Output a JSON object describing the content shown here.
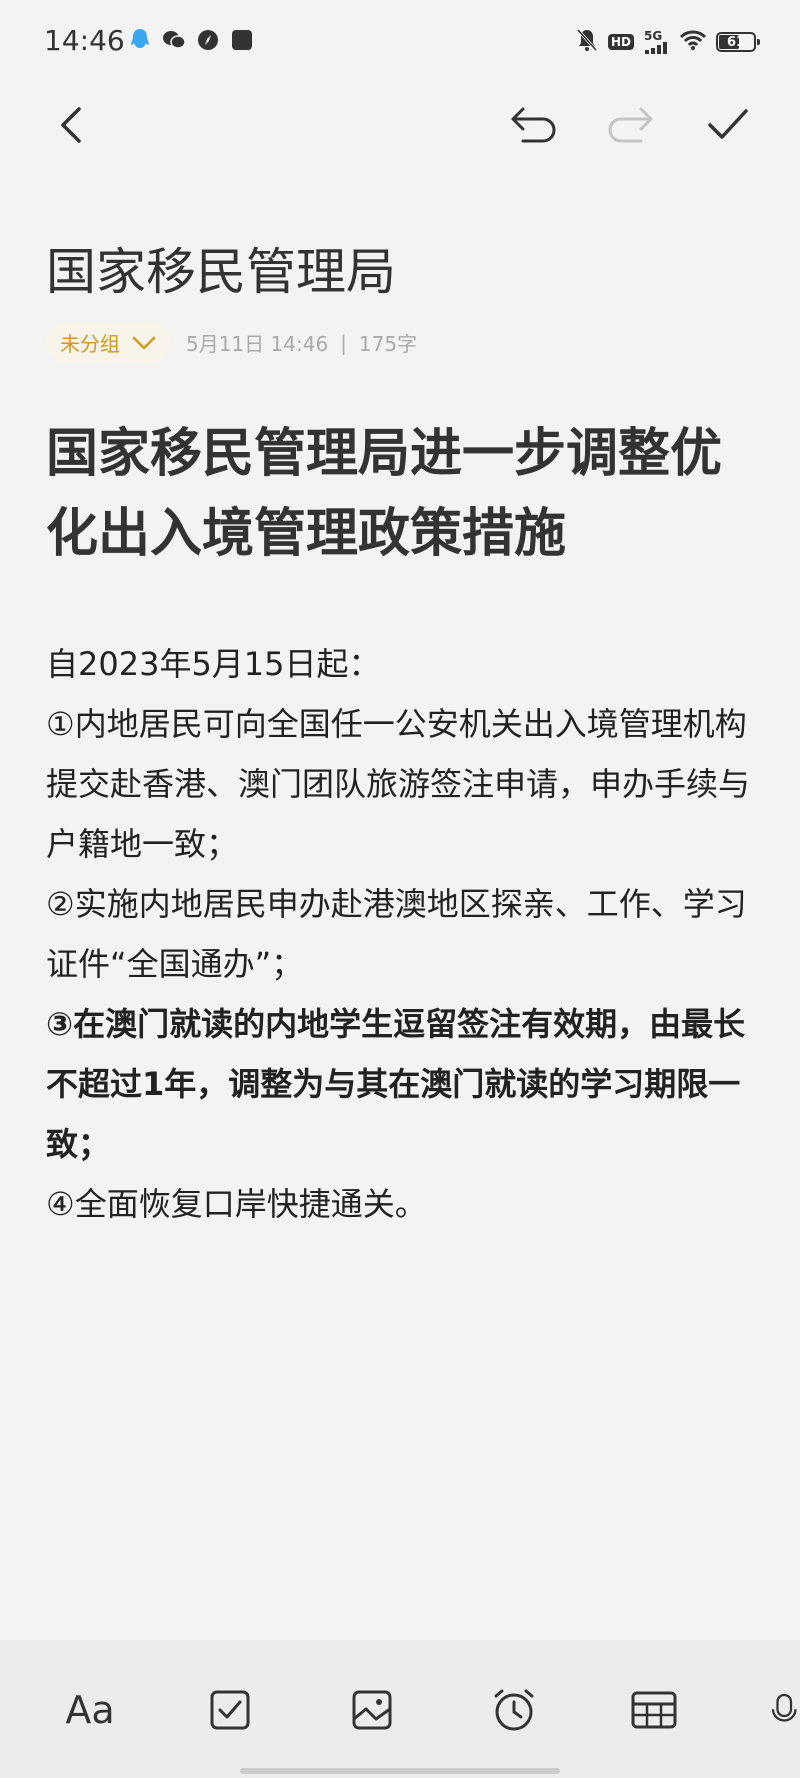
{
  "status_bar": {
    "time": "14:46",
    "network": "5G",
    "hd": "HD",
    "battery": "61",
    "battery_level": 0.61,
    "notification_icons": [
      "qq-icon",
      "wechat-icon",
      "compass-icon",
      "square-app-icon"
    ],
    "system_icons": [
      "bell-muted-icon",
      "hd-icon",
      "signal-5g-icon",
      "wifi-icon",
      "battery-icon"
    ]
  },
  "toolbar": {
    "icons": [
      "back-arrow-icon",
      "undo-icon",
      "redo-icon",
      "check-icon"
    ]
  },
  "note": {
    "title": "国家移民管理局",
    "group": "未分组",
    "date": "5月11日 14:46",
    "separator": "|",
    "word_count": "175字",
    "heading": "国家移民管理局进一步调整优化出入境管理政策措施",
    "paragraphs": [
      "自2023年5月15日起：",
      "①内地居民可向全国任一公安机关出入境管理机构提交赴香港、澳门团队旅游签注申请，申办手续与户籍地一致；",
      "②实施内地居民申办赴港澳地区探亲、工作、学习证件“全国通办”；",
      "③在澳门就读的内地学生逗留签注有效期，由最长不超过1年，调整为与其在澳门就读的学习期限一致；",
      "④全面恢复口岸快捷通关。"
    ]
  },
  "bottom_toolbar": {
    "font_label": "Aa",
    "icons": [
      "text-format-icon",
      "checkbox-icon",
      "image-icon",
      "alarm-clock-icon",
      "table-icon",
      "microphone-icon"
    ]
  },
  "colors": {
    "background": "#f3f3f3",
    "text": "#222222",
    "accent": "#d19a19",
    "muted": "#aaaaaa"
  }
}
